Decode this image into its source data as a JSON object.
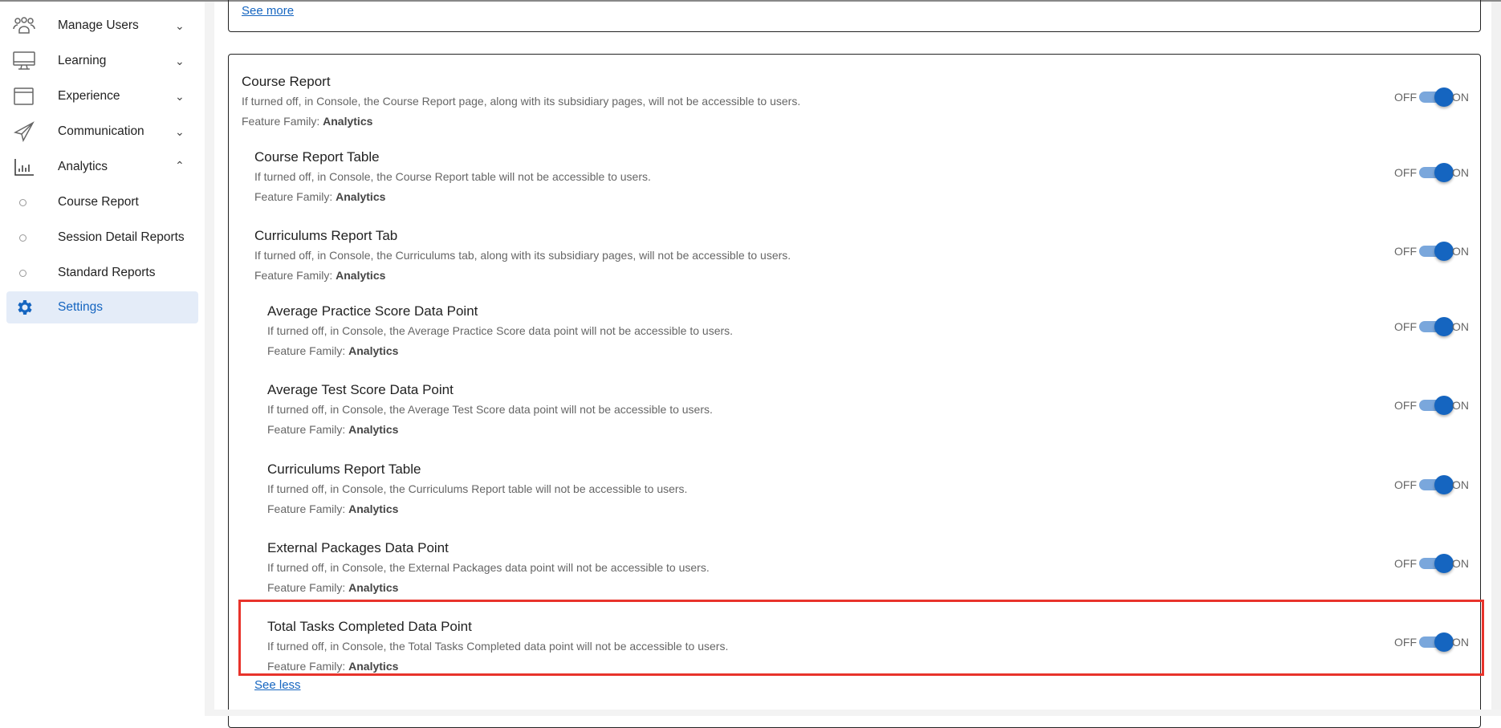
{
  "sidebar": {
    "items": [
      {
        "label": "Manage Users",
        "icon": "users-icon",
        "expanded": false
      },
      {
        "label": "Learning",
        "icon": "monitor-icon",
        "expanded": false
      },
      {
        "label": "Experience",
        "icon": "window-icon",
        "expanded": false
      },
      {
        "label": "Communication",
        "icon": "paper-plane-icon",
        "expanded": false
      },
      {
        "label": "Analytics",
        "icon": "bar-chart-icon",
        "expanded": true
      }
    ],
    "sub_items": [
      {
        "label": "Course Report"
      },
      {
        "label": "Session Detail Reports"
      },
      {
        "label": "Standard Reports"
      }
    ],
    "active": {
      "label": "Settings",
      "icon": "gear-icon"
    }
  },
  "main": {
    "see_more": "See more",
    "see_less": "See less",
    "toggle": {
      "off": "OFF",
      "on": "ON"
    },
    "family_label": "Feature Family:",
    "features": [
      {
        "title": "Course Report",
        "desc": "If turned off, in Console, the Course Report page, along with its subsidiary pages, will not be accessible to users.",
        "family": "Analytics",
        "on": true
      },
      {
        "title": "Course Report Table",
        "desc": "If turned off, in Console, the Course Report table will not be accessible to users.",
        "family": "Analytics",
        "on": true
      },
      {
        "title": "Curriculums Report Tab",
        "desc": "If turned off, in Console, the Curriculums tab, along with its subsidiary pages, will not be accessible to users.",
        "family": "Analytics",
        "on": true
      },
      {
        "title": "Average Practice Score Data Point",
        "desc": "If turned off, in Console, the Average Practice Score data point will not be accessible to users.",
        "family": "Analytics",
        "on": true
      },
      {
        "title": "Average Test Score Data Point",
        "desc": "If turned off, in Console, the Average Test Score data point will not be accessible to users.",
        "family": "Analytics",
        "on": true
      },
      {
        "title": "Curriculums Report Table",
        "desc": "If turned off, in Console, the Curriculums Report table will not be accessible to users.",
        "family": "Analytics",
        "on": true
      },
      {
        "title": "External Packages Data Point",
        "desc": "If turned off, in Console, the External Packages data point will not be accessible to users.",
        "family": "Analytics",
        "on": true
      },
      {
        "title": "Total Tasks Completed Data Point",
        "desc": "If turned off, in Console, the Total Tasks Completed data point will not be accessible to users.",
        "family": "Analytics",
        "on": true
      }
    ]
  }
}
